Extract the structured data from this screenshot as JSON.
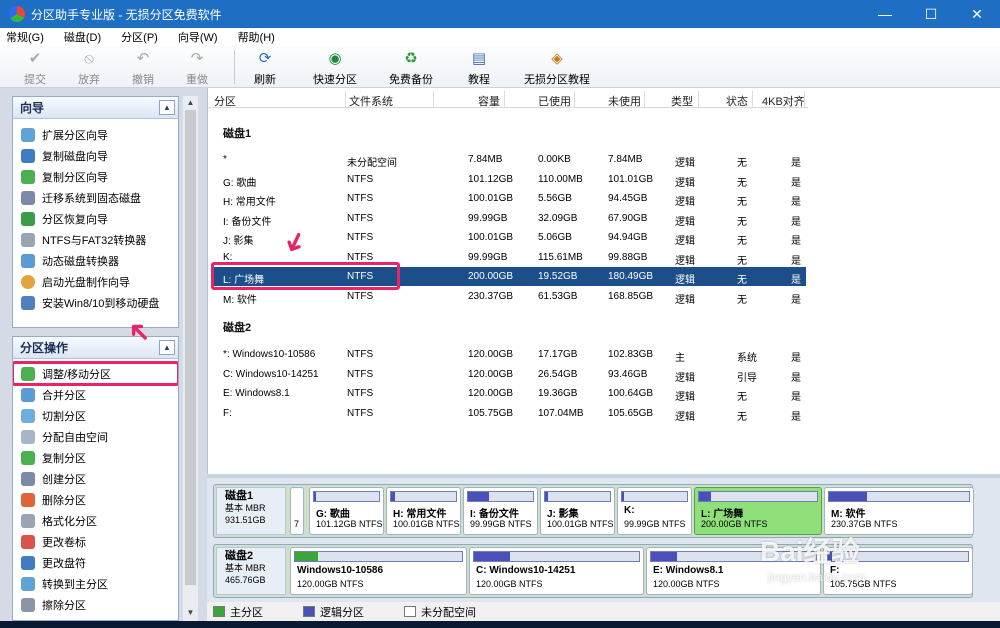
{
  "window": {
    "title": "分区助手专业版 - 无损分区免费软件",
    "min": "—",
    "max": "☐",
    "close": "✕"
  },
  "menu": [
    "常规(G)",
    "磁盘(D)",
    "分区(P)",
    "向导(W)",
    "帮助(H)"
  ],
  "toolbar": {
    "commit": "提交",
    "discard": "放弃",
    "undo": "撤销",
    "redo": "重做",
    "refresh": "刷新",
    "quick_partition": "快速分区",
    "free_backup": "免费备份",
    "tutorial": "教程",
    "lossless_tutorial": "无损分区教程"
  },
  "wizard": {
    "title": "向导",
    "items": [
      "扩展分区向导",
      "复制磁盘向导",
      "复制分区向导",
      "迁移系统到固态磁盘",
      "分区恢复向导",
      "NTFS与FAT32转换器",
      "动态磁盘转换器",
      "启动光盘制作向导",
      "安装Win8/10到移动硬盘"
    ]
  },
  "ops": {
    "title": "分区操作",
    "items": [
      "调整/移动分区",
      "合并分区",
      "切割分区",
      "分配自由空间",
      "复制分区",
      "创建分区",
      "删除分区",
      "格式化分区",
      "更改卷标",
      "更改盘符",
      "转换到主分区",
      "擦除分区"
    ]
  },
  "table": {
    "headers": {
      "partition": "分区",
      "fs": "文件系统",
      "capacity": "容量",
      "used": "已使用",
      "unused": "未使用",
      "type": "类型",
      "status": "状态",
      "align": "4KB对齐"
    },
    "disk1": {
      "label": "磁盘1",
      "rows": [
        {
          "name": "*",
          "fs": "未分配空间",
          "cap": "7.84MB",
          "used": "0.00KB",
          "free": "7.84MB",
          "type": "逻辑",
          "status": "无",
          "align": "是"
        },
        {
          "name": "G: 歌曲",
          "fs": "NTFS",
          "cap": "101.12GB",
          "used": "110.00MB",
          "free": "101.01GB",
          "type": "逻辑",
          "status": "无",
          "align": "是"
        },
        {
          "name": "H: 常用文件",
          "fs": "NTFS",
          "cap": "100.01GB",
          "used": "5.56GB",
          "free": "94.45GB",
          "type": "逻辑",
          "status": "无",
          "align": "是"
        },
        {
          "name": "I: 备份文件",
          "fs": "NTFS",
          "cap": "99.99GB",
          "used": "32.09GB",
          "free": "67.90GB",
          "type": "逻辑",
          "status": "无",
          "align": "是"
        },
        {
          "name": "J: 影集",
          "fs": "NTFS",
          "cap": "100.01GB",
          "used": "5.06GB",
          "free": "94.94GB",
          "type": "逻辑",
          "status": "无",
          "align": "是"
        },
        {
          "name": "K:",
          "fs": "NTFS",
          "cap": "99.99GB",
          "used": "115.61MB",
          "free": "99.88GB",
          "type": "逻辑",
          "status": "无",
          "align": "是"
        },
        {
          "name": "L: 广场舞",
          "fs": "NTFS",
          "cap": "200.00GB",
          "used": "19.52GB",
          "free": "180.49GB",
          "type": "逻辑",
          "status": "无",
          "align": "是"
        },
        {
          "name": "M: 软件",
          "fs": "NTFS",
          "cap": "230.37GB",
          "used": "61.53GB",
          "free": "168.85GB",
          "type": "逻辑",
          "status": "无",
          "align": "是"
        }
      ]
    },
    "disk2": {
      "label": "磁盘2",
      "rows": [
        {
          "name": "*: Windows10-10586",
          "fs": "NTFS",
          "cap": "120.00GB",
          "used": "17.17GB",
          "free": "102.83GB",
          "type": "主",
          "status": "系统",
          "align": "是"
        },
        {
          "name": "C: Windows10-14251",
          "fs": "NTFS",
          "cap": "120.00GB",
          "used": "26.54GB",
          "free": "93.46GB",
          "type": "逻辑",
          "status": "引导",
          "align": "是"
        },
        {
          "name": "E: Windows8.1",
          "fs": "NTFS",
          "cap": "120.00GB",
          "used": "19.36GB",
          "free": "100.64GB",
          "type": "逻辑",
          "status": "无",
          "align": "是"
        },
        {
          "name": "F:",
          "fs": "NTFS",
          "cap": "105.75GB",
          "used": "107.04MB",
          "free": "105.65GB",
          "type": "逻辑",
          "status": "无",
          "align": "是"
        }
      ]
    }
  },
  "diskmap": {
    "disk1": {
      "name": "磁盘1",
      "type": "基本 MBR",
      "size": "931.51GB",
      "unalloc_label": "7",
      "parts": [
        {
          "name": "G: 歌曲",
          "desc": "101.12GB NTFS",
          "used_frac": 0.01
        },
        {
          "name": "H: 常用文件",
          "desc": "100.01GB NTFS",
          "used_frac": 0.06
        },
        {
          "name": "I: 备份文件",
          "desc": "99.99GB NTFS",
          "used_frac": 0.32
        },
        {
          "name": "J: 影集",
          "desc": "100.01GB NTFS",
          "used_frac": 0.05
        },
        {
          "name": "K:",
          "desc": "99.99GB NTFS",
          "used_frac": 0.01
        },
        {
          "name": "L: 广场舞",
          "desc": "200.00GB NTFS",
          "used_frac": 0.1
        },
        {
          "name": "M: 软件",
          "desc": "230.37GB NTFS",
          "used_frac": 0.27
        }
      ]
    },
    "disk2": {
      "name": "磁盘2",
      "type": "基本 MBR",
      "size": "465.76GB",
      "parts": [
        {
          "name": "Windows10-10586",
          "desc": "120.00GB NTFS",
          "used_frac": 0.14
        },
        {
          "name": "C: Windows10-14251",
          "desc": "120.00GB NTFS",
          "used_frac": 0.22
        },
        {
          "name": "E: Windows8.1",
          "desc": "120.00GB NTFS",
          "used_frac": 0.16
        },
        {
          "name": "F:",
          "desc": "105.75GB NTFS",
          "used_frac": 0.01
        }
      ]
    }
  },
  "legend": {
    "primary": "主分区",
    "logical": "逻辑分区",
    "unallocated": "未分配空间"
  },
  "watermark": {
    "text": "Bai经验",
    "sub": "jingyan.baidu.com"
  },
  "colors": {
    "titlebar": "#1e6fc4",
    "selected_row": "#1c4f8a",
    "highlight": "#e8236a",
    "primary": "#3aa63a",
    "logical": "#4b4fb8"
  }
}
